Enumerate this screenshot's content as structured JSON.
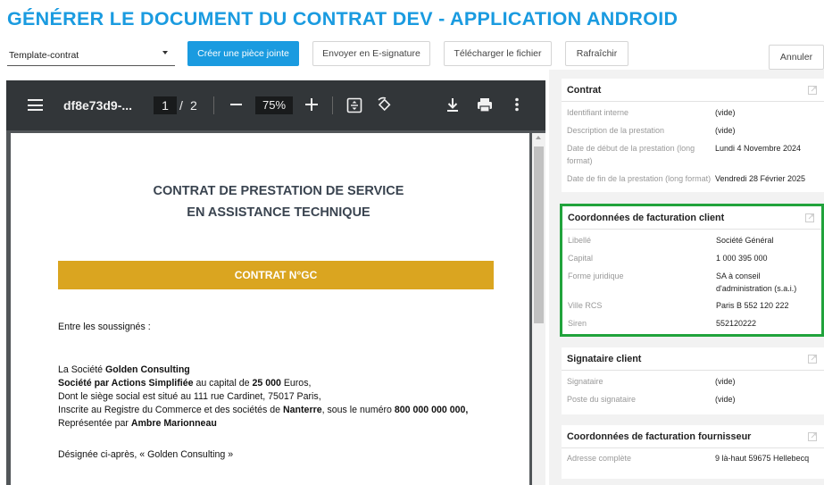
{
  "header": {
    "title": "GÉNÉRER LE DOCUMENT DU CONTRAT DEV - APPLICATION ANDROID"
  },
  "toolbar": {
    "template_select": "Template-contrat",
    "create_attachment": "Créer une pièce jointe",
    "send_esignature": "Envoyer en E-signature",
    "download_file": "Télécharger le fichier",
    "refresh": "Rafraîchir",
    "cancel": "Annuler"
  },
  "viewer": {
    "doc_name": "df8e73d9-...",
    "page_current": "1",
    "page_separator": "/",
    "page_total": "2",
    "zoom": "75%"
  },
  "document": {
    "title_line1": "CONTRAT DE PRESTATION DE SERVICE",
    "title_line2": "EN ASSISTANCE TECHNIQUE",
    "banner": "CONTRAT N°GC",
    "between": "Entre les soussignés :",
    "company_prefix": "La Société ",
    "company_name": "Golden Consulting",
    "form_label": "Société par Actions Simplifiée",
    "capital_text": " au capital de ",
    "capital_value": "25 000",
    "capital_suffix": " Euros,",
    "seat": "Dont le siège social est situé au 111 rue Cardinet, 75017 Paris,",
    "registry_prefix": "Inscrite au Registre du Commerce et des sociétés de ",
    "registry_city": "Nanterre",
    "registry_mid": ", sous le numéro ",
    "registry_number": "800 000 000 000,",
    "represented_by": "Représentée par ",
    "representative": "Ambre Marionneau",
    "designated": "Désignée ci-après, « Golden Consulting »"
  },
  "panel": {
    "contrat": {
      "title": "Contrat",
      "rows": [
        {
          "label": "Identifiant interne",
          "value": "(vide)"
        },
        {
          "label": "Description de la prestation",
          "value": "(vide)"
        },
        {
          "label_1": "Date de début de la prestation (long",
          "label_2": "format)",
          "value": "Lundi 4 Novembre 2024"
        },
        {
          "label": "Date de fin de la prestation (long format)",
          "value": "Vendredi 28 Février 2025"
        }
      ]
    },
    "facturation_client": {
      "title": "Coordonnées de facturation client",
      "rows": [
        {
          "label": "Libellé",
          "value": "Société Général"
        },
        {
          "label": "Capital",
          "value": "1 000 395 000"
        },
        {
          "label": "Forme juridique",
          "value_1": "SA à conseil",
          "value_2": "d'administration (s.a.i.)"
        },
        {
          "label": "Ville RCS",
          "value": "Paris B 552 120 222"
        },
        {
          "label": "Siren",
          "value": "552120222"
        }
      ]
    },
    "signataire": {
      "title": "Signataire client",
      "rows": [
        {
          "label": "Signataire",
          "value": "(vide)"
        },
        {
          "label": "Poste du signataire",
          "value": "(vide)"
        }
      ]
    },
    "facturation_fournisseur": {
      "title": "Coordonnées de facturation fournisseur",
      "rows": [
        {
          "label": "Adresse complète",
          "value": "9 là-haut 59675 Hellebecq"
        }
      ]
    }
  },
  "colors": {
    "accent": "#1a9be0",
    "banner": "#daa520",
    "highlight": "#21a33c",
    "viewer_toolbar": "#323639"
  }
}
